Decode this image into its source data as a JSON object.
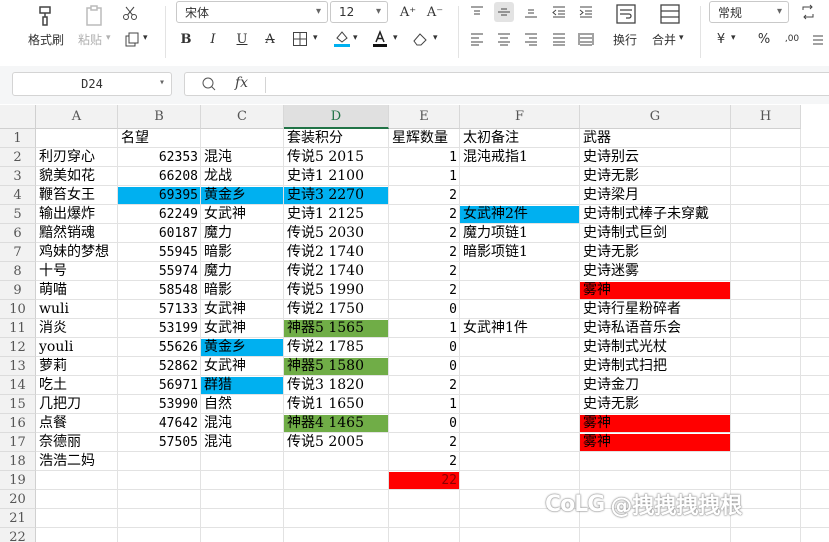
{
  "ribbon": {
    "format_painter": "格式刷",
    "paste": "粘贴",
    "font_name": "宋体",
    "font_size": "12",
    "number_format": "常规",
    "wrap_text": "换行",
    "merge": "合并",
    "bold": "B",
    "italic": "I",
    "underline": "U",
    "strikethrough": "A",
    "increase_font": "A⁺",
    "decrease_font": "A⁻",
    "currency": "¥",
    "percent": "%"
  },
  "formula_bar": {
    "name_box": "D24",
    "fx": "fx"
  },
  "columns": [
    "A",
    "B",
    "C",
    "D",
    "E",
    "F",
    "G",
    "H"
  ],
  "row_numbers": [
    "1",
    "2",
    "3",
    "4",
    "5",
    "6",
    "7",
    "8",
    "9",
    "10",
    "11",
    "12",
    "13",
    "14",
    "15",
    "16",
    "17",
    "18",
    "19",
    "20",
    "21",
    "22"
  ],
  "colors": {
    "blue": "#00b0f0",
    "green": "#70ad47",
    "red": "#ff0000",
    "selected_header": "#217346"
  },
  "rows": [
    {
      "r": 1,
      "A": "",
      "B": "名望",
      "C": "",
      "D": "套装积分",
      "E": "星辉数量",
      "F": "太初备注",
      "G": "武器"
    },
    {
      "r": 2,
      "A": "利刃穿心",
      "B": "62353",
      "C": "混沌",
      "D": "传说5 2015",
      "E": "1",
      "F": "混沌戒指1",
      "G": "史诗别云"
    },
    {
      "r": 3,
      "A": "貌美如花",
      "B": "66208",
      "C": "龙战",
      "D": "史诗1 2100",
      "E": "1",
      "F": "",
      "G": "史诗无影"
    },
    {
      "r": 4,
      "A": "鞭笞女王",
      "B": "69395",
      "C": "黄金乡",
      "D": "史诗3 2270",
      "E": "2",
      "F": "",
      "G": "史诗梁月"
    },
    {
      "r": 5,
      "A": "输出爆炸",
      "B": "62249",
      "C": "女武神",
      "D": "史诗1 2125",
      "E": "2",
      "F": "女武神2件",
      "G": "史诗制式棒子未穿戴"
    },
    {
      "r": 6,
      "A": "黯然销魂",
      "B": "60187",
      "C": "魔力",
      "D": "传说5 2030",
      "E": "2",
      "F": "魔力项链1",
      "G": "史诗制式巨剑"
    },
    {
      "r": 7,
      "A": "鸡妹的梦想",
      "B": "55945",
      "C": "暗影",
      "D": "传说2 1740",
      "E": "2",
      "F": "暗影项链1",
      "G": "史诗无影"
    },
    {
      "r": 8,
      "A": "十号",
      "B": "55974",
      "C": "魔力",
      "D": "传说2 1740",
      "E": "2",
      "F": "",
      "G": "史诗迷雾"
    },
    {
      "r": 9,
      "A": "萌喵",
      "B": "58548",
      "C": "暗影",
      "D": "传说5 1990",
      "E": "2",
      "F": "",
      "G": "雾神"
    },
    {
      "r": 10,
      "A": "wuli",
      "B": "57133",
      "C": "女武神",
      "D": "传说2 1750",
      "E": "0",
      "F": "",
      "G": "史诗行星粉碎者"
    },
    {
      "r": 11,
      "A": "消炎",
      "B": "53199",
      "C": "女武神",
      "D": "神器5 1565",
      "E": "1",
      "F": "女武神1件",
      "G": "史诗私语音乐会"
    },
    {
      "r": 12,
      "A": "youli",
      "B": "55626",
      "C": "黄金乡",
      "D": "传说2 1785",
      "E": "0",
      "F": "",
      "G": "史诗制式光杖"
    },
    {
      "r": 13,
      "A": "萝莉",
      "B": "52862",
      "C": "女武神",
      "D": "神器5 1580",
      "E": "0",
      "F": "",
      "G": "史诗制式扫把"
    },
    {
      "r": 14,
      "A": "吃土",
      "B": "56971",
      "C": "群猎",
      "D": "传说3 1820",
      "E": "2",
      "F": "",
      "G": "史诗金刀"
    },
    {
      "r": 15,
      "A": "几把刀",
      "B": "53990",
      "C": "自然",
      "D": "传说1 1650",
      "E": "1",
      "F": "",
      "G": "史诗无影"
    },
    {
      "r": 16,
      "A": "点餐",
      "B": "47642",
      "C": "混沌",
      "D": "神器4 1465",
      "E": "0",
      "F": "",
      "G": "雾神"
    },
    {
      "r": 17,
      "A": "奈德丽",
      "B": "57505",
      "C": "混沌",
      "D": "传说5 2005",
      "E": "2",
      "F": "",
      "G": "雾神"
    },
    {
      "r": 18,
      "A": "浩浩二妈",
      "B": "",
      "C": "",
      "D": "",
      "E": "2",
      "F": "",
      "G": ""
    },
    {
      "r": 19,
      "A": "",
      "B": "",
      "C": "",
      "D": "",
      "E": "22",
      "F": "",
      "G": ""
    }
  ],
  "watermark": {
    "logo": "CoLG",
    "handle": "@拽拽拽拽根"
  }
}
